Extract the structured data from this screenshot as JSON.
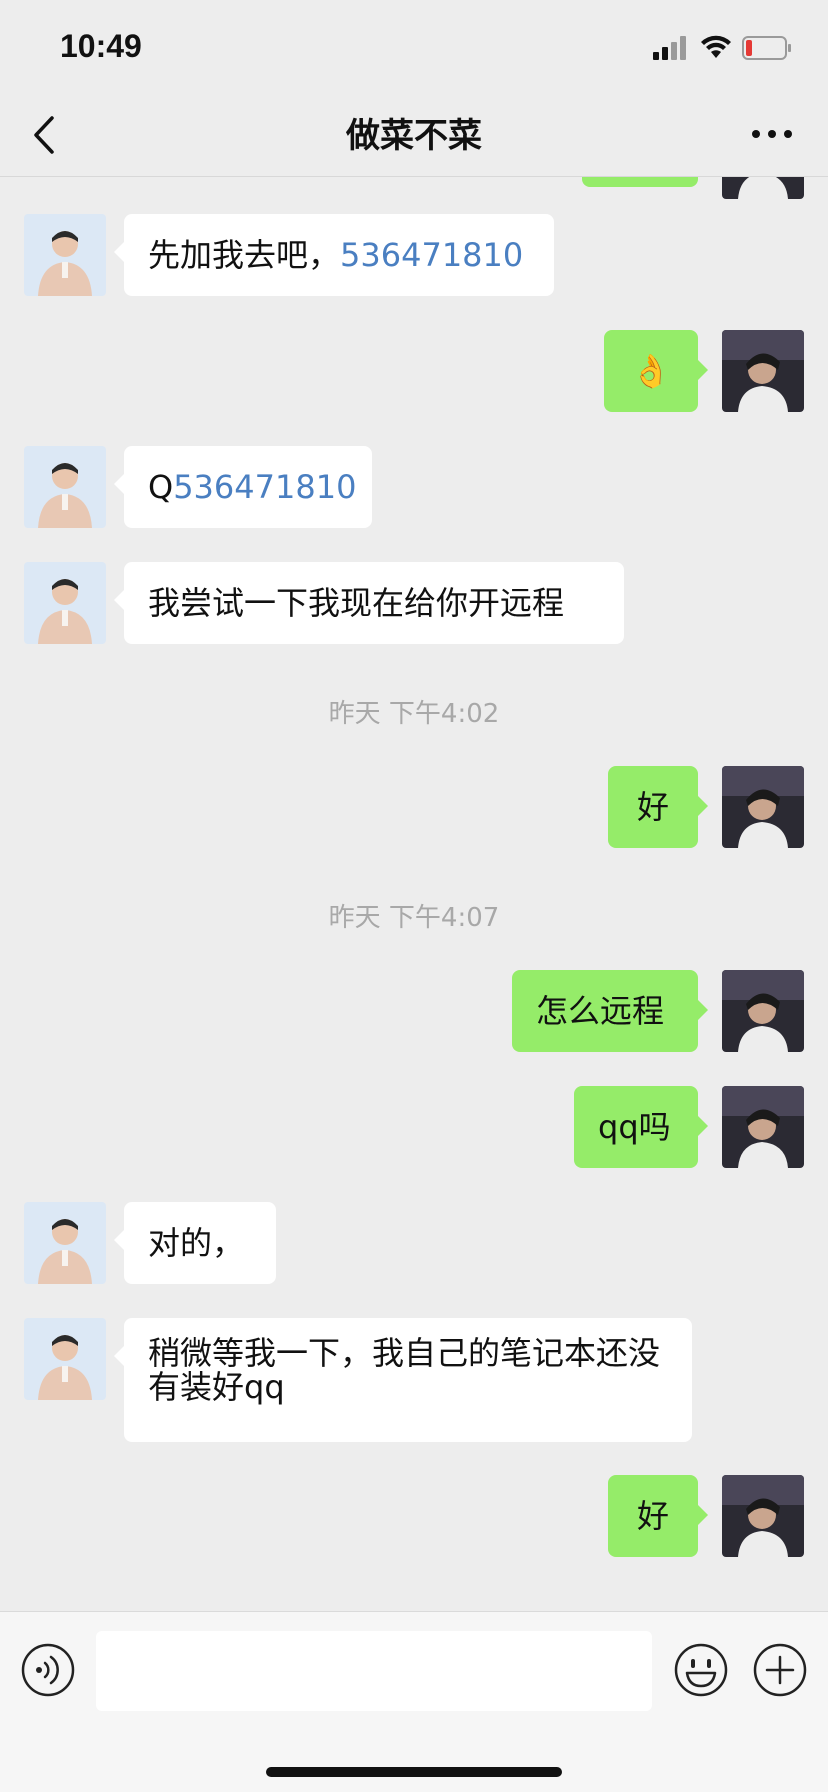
{
  "status_bar": {
    "time": "10:49"
  },
  "nav": {
    "title": "做菜不菜"
  },
  "messages": [
    {
      "side": "left",
      "text": "先加我去吧，",
      "link": "536471810"
    },
    {
      "side": "right",
      "text": "👌"
    },
    {
      "side": "left",
      "text": "Q",
      "link": "536471810"
    },
    {
      "side": "left",
      "text": "我尝试一下我现在给你开远程"
    },
    {
      "type": "time",
      "text": "昨天 下午4:02"
    },
    {
      "side": "right",
      "text": "好"
    },
    {
      "type": "time",
      "text": "昨天 下午4:07"
    },
    {
      "side": "right",
      "text": "怎么远程"
    },
    {
      "side": "right",
      "text": "qq吗"
    },
    {
      "side": "left",
      "text": "对的，"
    },
    {
      "side": "left",
      "text": "稍微等我一下，我自己的笔记本还没有装好qq"
    },
    {
      "side": "right",
      "text": "好"
    }
  ],
  "input": {
    "value": "",
    "placeholder": ""
  },
  "colors": {
    "background": "#EDEDED",
    "self_bubble": "#95EC69",
    "other_bubble": "#FFFFFF",
    "link": "#4A7FC1",
    "timestamp": "#A8A8A8"
  },
  "icons": [
    "signal-icon",
    "wifi-icon",
    "battery-icon",
    "back-icon",
    "more-icon",
    "voice-icon",
    "emoji-icon",
    "plus-icon"
  ]
}
